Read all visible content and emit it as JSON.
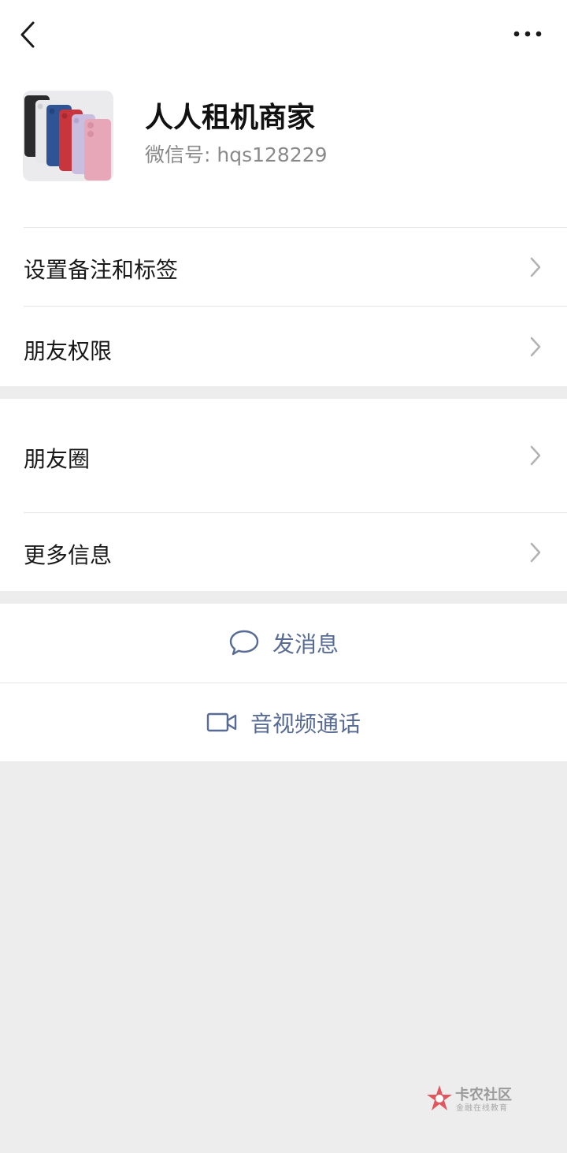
{
  "contact": {
    "name": "人人租机商家",
    "wechat_id": "微信号: hqs128229",
    "avatar": "iphone-colors-photo"
  },
  "settings_group": {
    "items": [
      {
        "label": "设置备注和标签"
      },
      {
        "label": "朋友权限"
      }
    ]
  },
  "info_group": {
    "items": [
      {
        "label": "朋友圈"
      },
      {
        "label": "更多信息"
      }
    ]
  },
  "actions": {
    "send_message": "发消息",
    "video_call": "音视频通话"
  },
  "watermark": {
    "title": "卡农社区",
    "subtitle": "金融在线教育"
  },
  "icons": {
    "back": "chevron-left-icon",
    "more": "more-dots-icon",
    "row_arrow": "chevron-right-icon",
    "message": "chat-bubble-icon",
    "video": "video-camera-icon"
  },
  "colors": {
    "background": "#ededed",
    "card": "#ffffff",
    "link": "#576b95",
    "text": "#181818",
    "secondary_text": "#8a8a8a",
    "chevron": "#b2b2b2"
  }
}
